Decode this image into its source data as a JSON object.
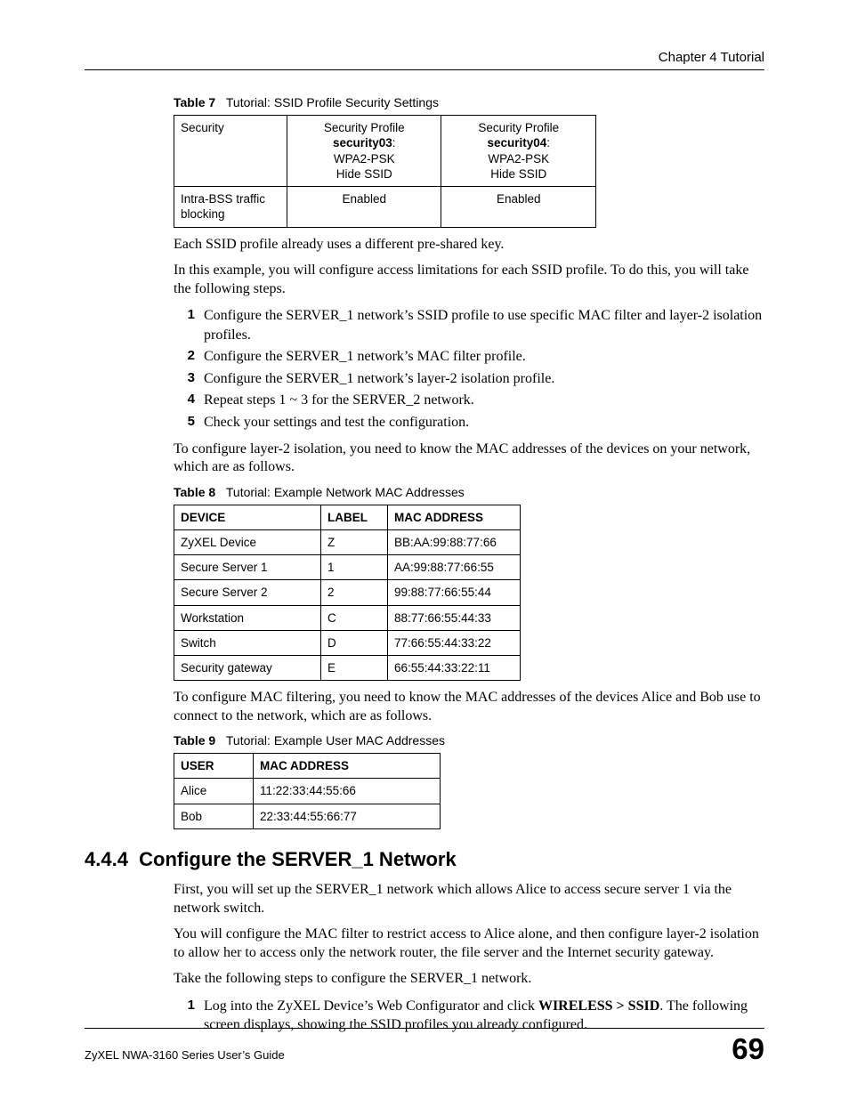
{
  "header": {
    "chapter": "Chapter 4 Tutorial"
  },
  "table7": {
    "caption_label": "Table 7",
    "caption_title": "Tutorial: SSID Profile Security Settings",
    "rows": [
      {
        "label": "Security",
        "col1_pre": "Security Profile ",
        "col1_bold": "security03",
        "col1_post": ":",
        "col1_line2": "WPA2-PSK",
        "col1_line3": "Hide SSID",
        "col2_pre": "Security Profile ",
        "col2_bold": "security04",
        "col2_post": ":",
        "col2_line2": "WPA2-PSK",
        "col2_line3": "Hide SSID"
      },
      {
        "label": "Intra-BSS traffic blocking",
        "col1": "Enabled",
        "col2": "Enabled"
      }
    ]
  },
  "para1": "Each SSID profile already uses a different pre-shared key.",
  "para2": "In this example, you will configure access limitations for each SSID profile. To do this, you will take the following steps.",
  "steps1": [
    "Configure the SERVER_1 network’s SSID profile to use specific MAC filter and layer-2 isolation profiles.",
    "Configure the SERVER_1 network’s MAC filter profile.",
    "Configure the SERVER_1 network’s layer-2 isolation profile.",
    "Repeat steps 1 ~ 3 for the SERVER_2 network.",
    "Check your settings and test the configuration."
  ],
  "para3": "To configure layer-2 isolation, you need to know the MAC addresses of the devices on your network, which are as follows.",
  "table8": {
    "caption_label": "Table 8",
    "caption_title": "Tutorial: Example Network MAC Addresses",
    "headers": [
      "DEVICE",
      "LABEL",
      "MAC ADDRESS"
    ],
    "rows": [
      [
        "ZyXEL Device",
        "Z",
        "BB:AA:99:88:77:66"
      ],
      [
        "Secure Server 1",
        "1",
        "AA:99:88:77:66:55"
      ],
      [
        "Secure Server 2",
        "2",
        "99:88:77:66:55:44"
      ],
      [
        "Workstation",
        "C",
        "88:77:66:55:44:33"
      ],
      [
        "Switch",
        "D",
        "77:66:55:44:33:22"
      ],
      [
        "Security gateway",
        "E",
        "66:55:44:33:22:11"
      ]
    ]
  },
  "para4": "To configure MAC filtering, you need to know the MAC addresses of the devices Alice and Bob use to connect to the network, which are as follows.",
  "table9": {
    "caption_label": "Table 9",
    "caption_title": "Tutorial: Example User MAC Addresses",
    "headers": [
      "USER",
      "MAC ADDRESS"
    ],
    "rows": [
      [
        "Alice",
        "11:22:33:44:55:66"
      ],
      [
        "Bob",
        "22:33:44:55:66:77"
      ]
    ]
  },
  "section": {
    "number": "4.4.4",
    "title": "Configure the SERVER_1 Network"
  },
  "para5": "First, you will set up the SERVER_1 network which allows Alice to access secure server 1 via the network switch.",
  "para6": "You will configure the MAC filter to restrict access to Alice alone, and then configure layer-2 isolation to allow her to access only the network router, the file server and the Internet security gateway.",
  "para7": "Take the following steps to configure the SERVER_1 network.",
  "steps2": {
    "pre": "Log into the ZyXEL Device’s Web Configurator and click ",
    "bold": "WIRELESS > SSID",
    "post": ". The following screen displays, showing the SSID profiles you already configured."
  },
  "footer": {
    "guide": "ZyXEL NWA-3160 Series User’s Guide",
    "page": "69"
  }
}
